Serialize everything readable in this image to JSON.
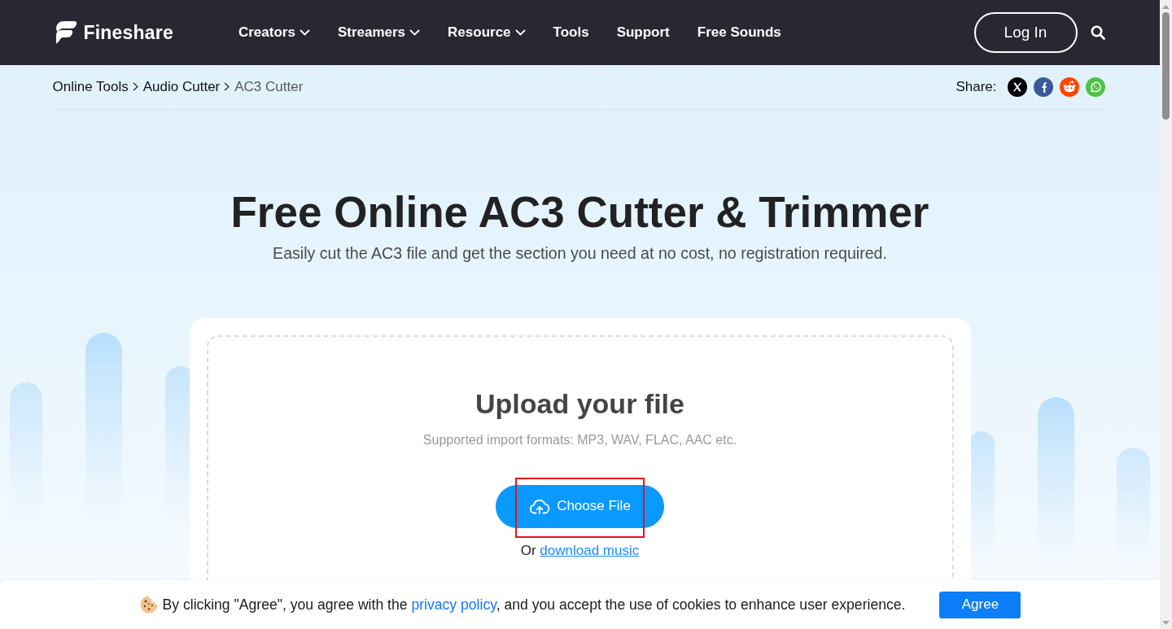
{
  "navbar": {
    "brand": "Fineshare",
    "links": [
      {
        "label": "Creators",
        "dropdown": true
      },
      {
        "label": "Streamers",
        "dropdown": true
      },
      {
        "label": "Resource",
        "dropdown": true
      },
      {
        "label": "Tools",
        "dropdown": false
      },
      {
        "label": "Support",
        "dropdown": false
      },
      {
        "label": "Free Sounds",
        "dropdown": false
      }
    ],
    "login_button": "Log In"
  },
  "breadcrumb": [
    {
      "label": "Online Tools",
      "current": false
    },
    {
      "label": "Audio Cutter",
      "current": false
    },
    {
      "label": "AC3 Cutter",
      "current": true
    }
  ],
  "share": {
    "label": "Share:"
  },
  "hero": {
    "title": "Free Online AC3 Cutter & Trimmer",
    "subtitle": "Easily cut the AC3 file and get the section you need at no cost, no registration required."
  },
  "upload": {
    "title": "Upload your file",
    "formats": "Supported import formats: MP3, WAV, FLAC, AAC etc.",
    "button": {
      "label": "Choose File",
      "highlighted": true
    },
    "alternative": {
      "prefix": "Or",
      "link": "download music"
    }
  },
  "cookie_banner": {
    "text_before": "By clicking \"Agree\", you agree with the ",
    "link": "privacy policy",
    "text_after": ", and you accept the use of cookies to enhance user experience.",
    "button": "Agree"
  }
}
